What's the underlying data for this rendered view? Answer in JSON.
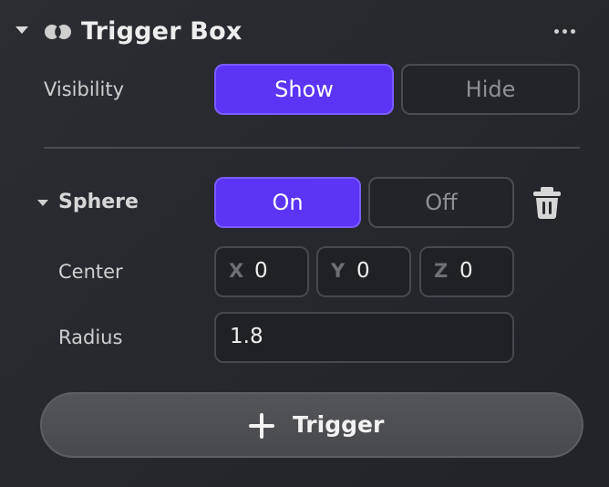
{
  "header": {
    "title": "Trigger Box",
    "icon": "overlapping-circles-icon",
    "more_icon": "more-horizontal-icon"
  },
  "visibility": {
    "label": "Visibility",
    "options": [
      "Show",
      "Hide"
    ],
    "selected": "Show"
  },
  "sphere": {
    "title": "Sphere",
    "toggle_options": [
      "On",
      "Off"
    ],
    "selected": "On",
    "delete_icon": "trash-icon",
    "center": {
      "label": "Center",
      "x_label": "X",
      "x_value": "0",
      "y_label": "Y",
      "y_value": "0",
      "z_label": "Z",
      "z_value": "0"
    },
    "radius": {
      "label": "Radius",
      "value": "1.8"
    }
  },
  "add_trigger": {
    "label": "Trigger",
    "icon": "plus-icon"
  },
  "colors": {
    "accent": "#5b34f5",
    "accent_border": "#7a5cff",
    "panel_bg": "#26282d"
  }
}
